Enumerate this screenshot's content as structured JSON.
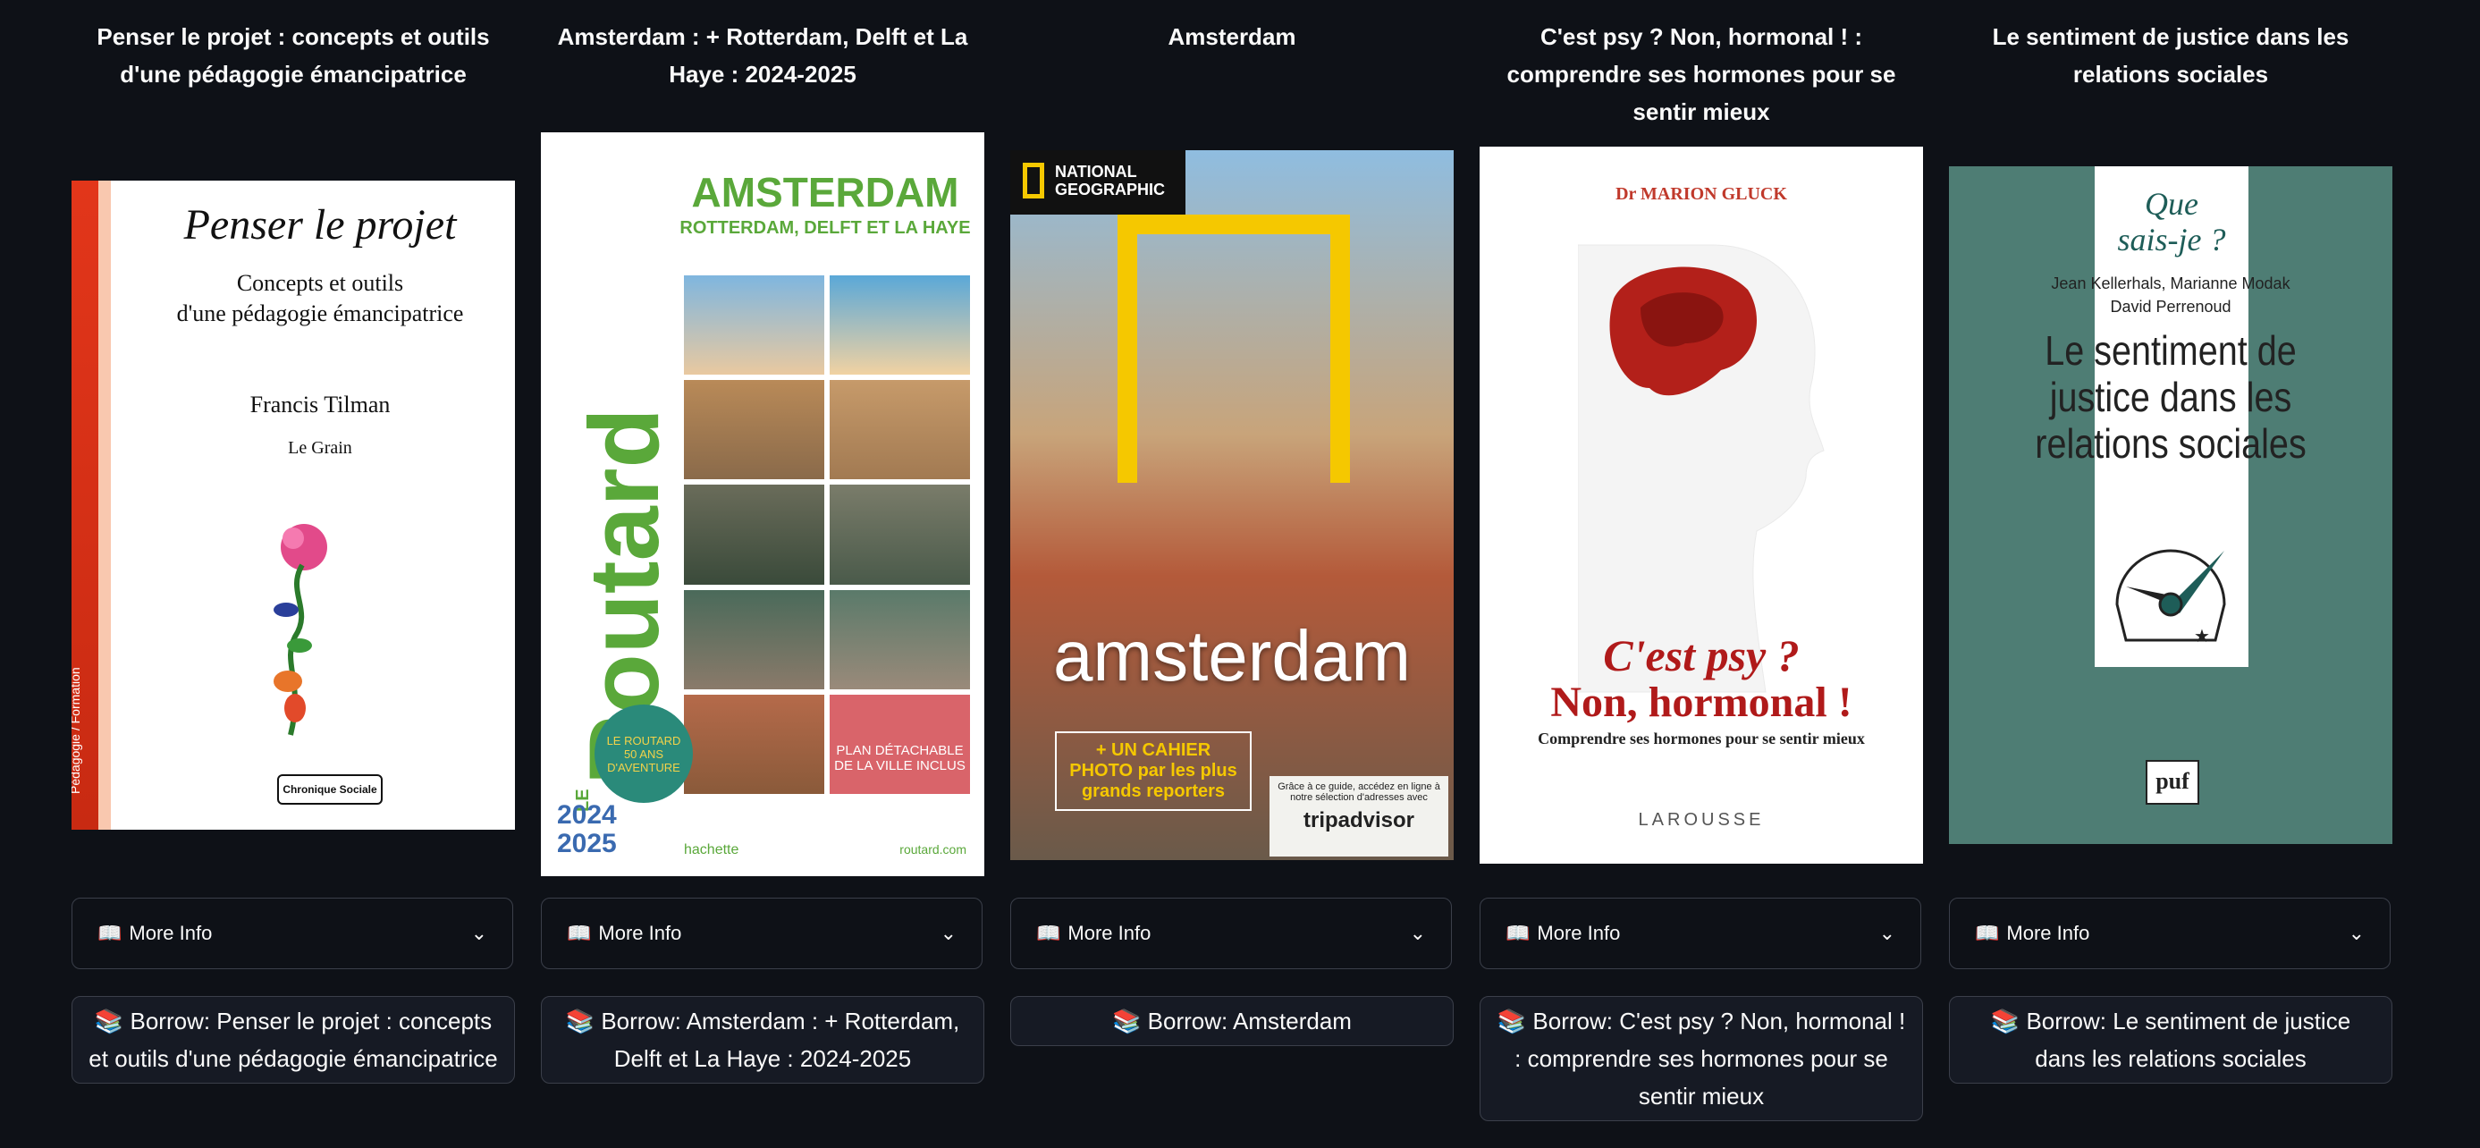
{
  "books": [
    {
      "title": "Penser le projet : concepts et outils d'une pédagogie émancipatrice",
      "cover": {
        "heading": "Penser le projet",
        "subtitle_line1": "Concepts et outils",
        "subtitle_line2": "d'une pédagogie émancipatrice",
        "author": "Francis Tilman",
        "publisher": "Le Grain",
        "series": "Pédagogie / Formation",
        "imprint": "Chronique Sociale"
      },
      "more_info": "More Info",
      "borrow_label": "Borrow: Penser le projet : concepts et outils d'une pédagogie émancipatrice"
    },
    {
      "title": "Amsterdam : + Rotterdam, Delft et La Haye : 2024-2025",
      "cover": {
        "heading": "AMSTERDAM",
        "subheading": "ROTTERDAM, DELFT ET LA HAYE",
        "brand": "Routard",
        "brand_prefix": "LE",
        "badge": "LE ROUTARD 50 ANS D'AVENTURE",
        "plan": "PLAN DÉTACHABLE DE LA VILLE INCLUS",
        "year": "2024 2025",
        "publisher": "hachette",
        "site": "routard.com"
      },
      "more_info": "More Info",
      "borrow_label": "Borrow: Amsterdam : + Rotterdam, Delft et La Haye : 2024-2025"
    },
    {
      "title": "Amsterdam",
      "cover": {
        "brand_line1": "NATIONAL",
        "brand_line2": "GEOGRAPHIC",
        "heading": "amsterdam",
        "promo": "+ UN CAHIER PHOTO par les plus grands reporters",
        "tripadvisor_note": "Grâce à ce guide, accédez en ligne à notre sélection d'adresses avec",
        "tripadvisor": "tripadvisor"
      },
      "more_info": "More Info",
      "borrow_label": "Borrow: Amsterdam"
    },
    {
      "title": "C'est psy ? Non, hormonal ! : comprendre ses hormones pour se sentir mieux",
      "cover": {
        "author": "Dr MARION GLUCK",
        "heading_line1": "C'est psy ?",
        "heading_line2": "Non, hormonal !",
        "subtitle": "Comprendre ses hormones pour se sentir mieux",
        "publisher": "LAROUSSE"
      },
      "more_info": "More Info",
      "borrow_label": "Borrow: C'est psy ? Non, hormonal ! : comprendre ses hormones pour se sentir mieux"
    },
    {
      "title": "Le sentiment de justice dans les relations sociales",
      "cover": {
        "series_line1": "Que",
        "series_line2": "sais-je ?",
        "authors_line1": "Jean Kellerhals, Marianne Modak",
        "authors_line2": "David Perrenoud",
        "heading": "Le sentiment de justice dans les relations sociales",
        "publisher": "puf"
      },
      "more_info": "More Info",
      "borrow_label": "Borrow: Le sentiment de justice dans les relations sociales"
    }
  ],
  "icons": {
    "book": "open-book-icon",
    "borrow": "books-stack-icon",
    "expand": "chevron-down-icon"
  },
  "colors": {
    "background": "#0e1117",
    "border": "#3b3f4a",
    "button_bg": "#161a24"
  }
}
